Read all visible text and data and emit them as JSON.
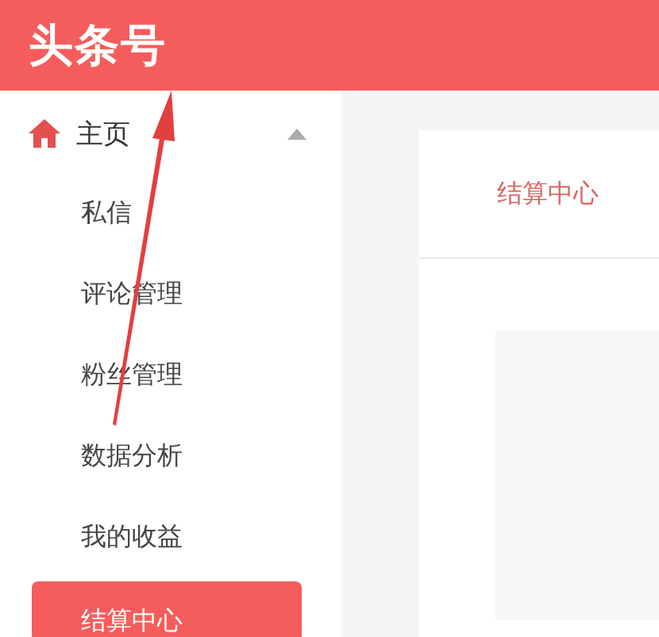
{
  "header": {
    "logo": "头条号"
  },
  "sidebar": {
    "group": {
      "label": "主页",
      "expanded": true
    },
    "items": [
      {
        "label": "私信",
        "selected": false
      },
      {
        "label": "评论管理",
        "selected": false
      },
      {
        "label": "粉丝管理",
        "selected": false
      },
      {
        "label": "数据分析",
        "selected": false
      },
      {
        "label": "我的收益",
        "selected": false
      },
      {
        "label": "结算中心",
        "selected": true
      }
    ]
  },
  "main": {
    "tabs": [
      {
        "label": "结算中心",
        "selected": true
      }
    ]
  }
}
